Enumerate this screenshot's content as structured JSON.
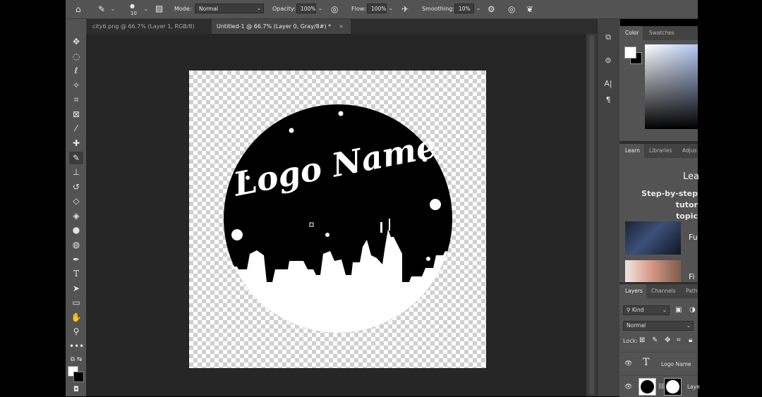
{
  "options_bar": {
    "brush_size": "10",
    "mode_label": "Mode:",
    "mode_value": "Normal",
    "opacity_label": "Opacity:",
    "opacity_value": "100%",
    "flow_label": "Flow:",
    "flow_value": "100%",
    "smoothing_label": "Smoothing:",
    "smoothing_value": "10%"
  },
  "tabs": [
    {
      "label": "city6.png @ 66.7% (Layer 1, RGB/8)",
      "close": "×",
      "active": false
    },
    {
      "label": "Untitled-1 @ 66.7% (Layer 0, Gray/8#) *",
      "close": "×",
      "active": true
    }
  ],
  "document": {
    "logo_text": "Logo Name"
  },
  "color_panel": {
    "tabs": [
      "Color",
      "Swatches"
    ]
  },
  "learn_panel": {
    "tabs": [
      "Learn",
      "Libraries",
      "Adjus"
    ],
    "heading": "Lea",
    "subheading_line1": "Step-by-step tutor",
    "subheading_line2": "topic",
    "cards": [
      "Fu",
      "Fi"
    ]
  },
  "layers_panel": {
    "tabs": [
      "Layers",
      "Channels",
      "Path"
    ],
    "filter_label": "Kind",
    "blend_mode": "Normal",
    "lock_label": "Lock:",
    "layers": [
      {
        "type_icon": "T",
        "name": "Logo Name"
      },
      {
        "name": "Laye"
      }
    ]
  },
  "colors": {
    "ui_dark": "#535353",
    "canvas_bg": "#262626",
    "foreground": "#ffffff",
    "background": "#000000"
  }
}
